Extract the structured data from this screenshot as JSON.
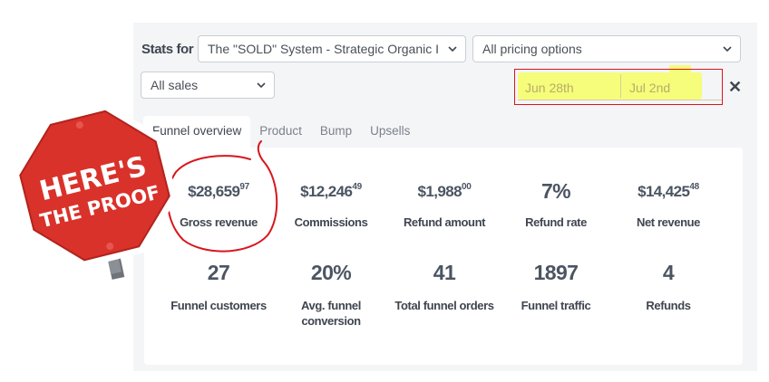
{
  "stats_for_label": "Stats for",
  "product_select": {
    "value": "The \"SOLD\" System - Strategic Organic I"
  },
  "pricing_select": {
    "value": "All pricing options"
  },
  "sales_select": {
    "value": "All sales"
  },
  "date_range": {
    "from": "Jun 28th",
    "to": "Jul 2nd"
  },
  "clear_icon": "close-icon",
  "tabs": [
    {
      "label": "Funnel overview",
      "active": true
    },
    {
      "label": "Product",
      "active": false
    },
    {
      "label": "Bump",
      "active": false
    },
    {
      "label": "Upsells",
      "active": false
    }
  ],
  "metrics_row1": [
    {
      "main": "$28,659",
      "cents": "97",
      "label": "Gross revenue"
    },
    {
      "main": "$12,246",
      "cents": "49",
      "label": "Commissions"
    },
    {
      "main": "$1,988",
      "cents": "00",
      "label": "Refund amount"
    },
    {
      "main": "7%",
      "cents": "",
      "label": "Refund rate"
    },
    {
      "main": "$14,425",
      "cents": "48",
      "label": "Net revenue"
    }
  ],
  "metrics_row2": [
    {
      "value": "27",
      "label": "Funnel customers"
    },
    {
      "value": "20%",
      "label": "Avg. funnel conversion"
    },
    {
      "value": "41",
      "label": "Total funnel orders"
    },
    {
      "value": "1897",
      "label": "Funnel traffic"
    },
    {
      "value": "4",
      "label": "Refunds"
    }
  ],
  "sign": {
    "line1": "HERE'S",
    "line2": "THE PROOF"
  },
  "colors": {
    "sign_red": "#d9322b",
    "annotation_red": "#d8161d",
    "highlight": "#f5fd7a"
  }
}
